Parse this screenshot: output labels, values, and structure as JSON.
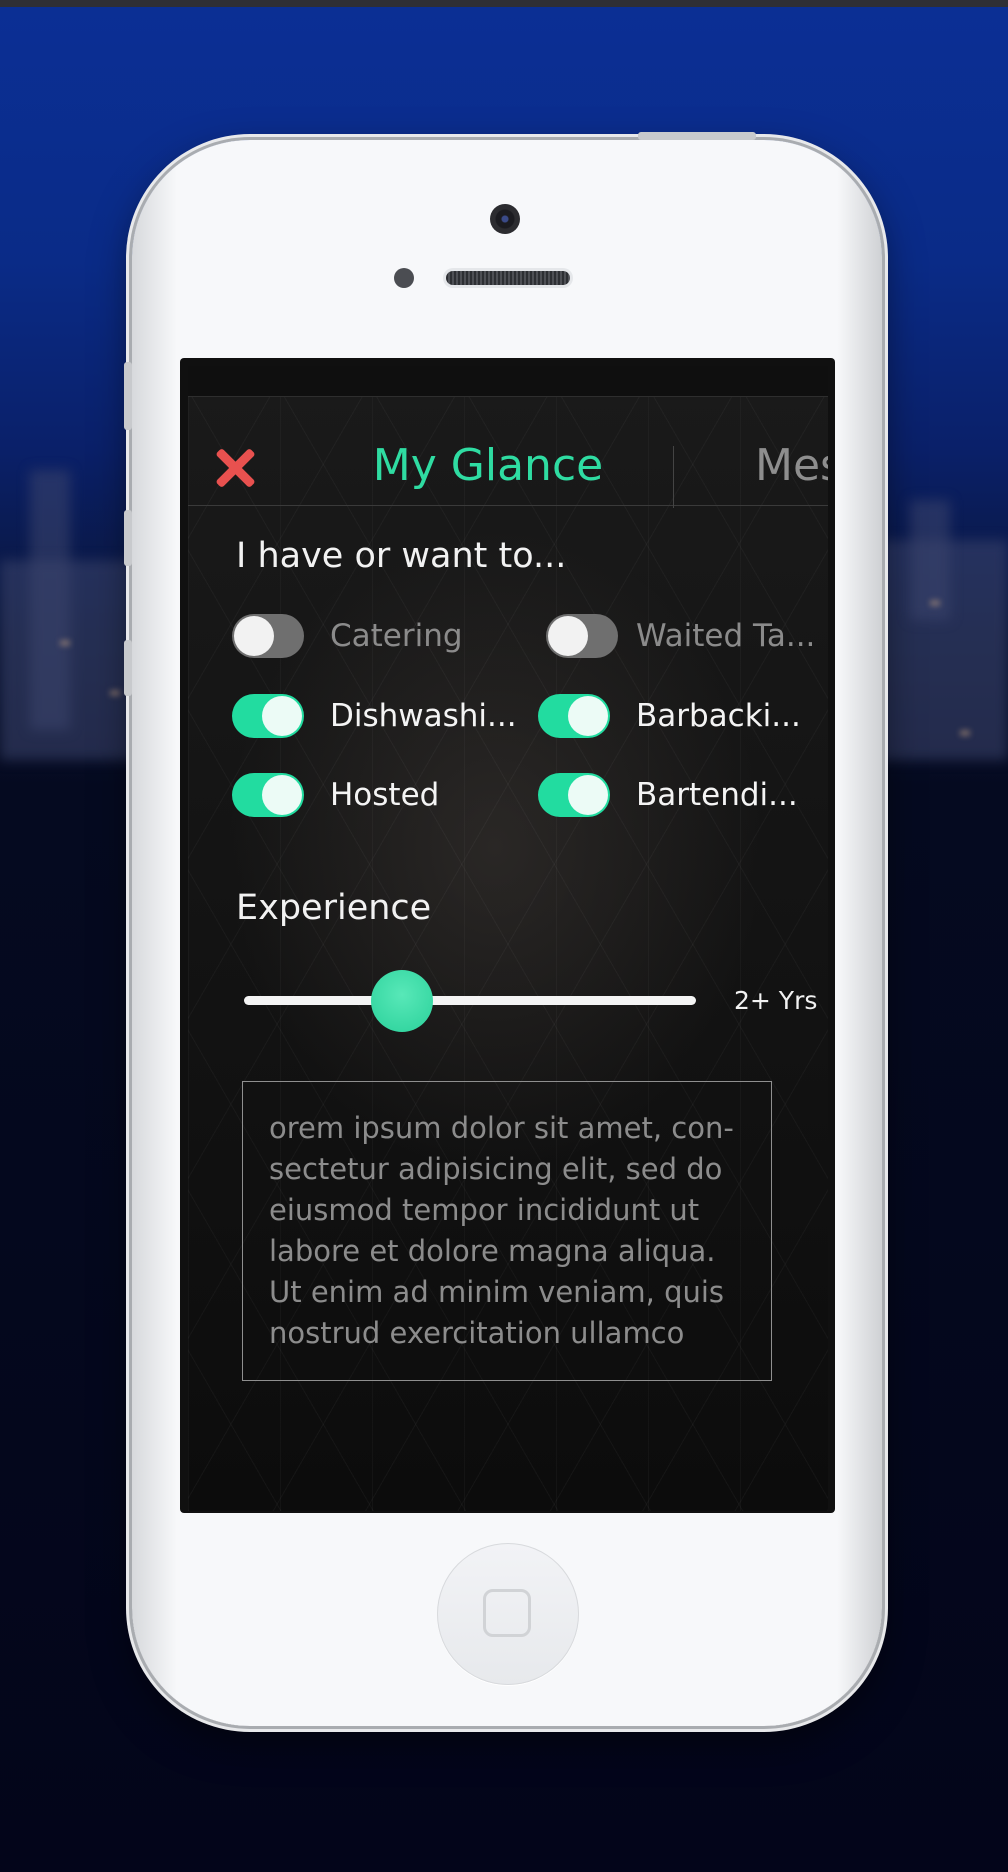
{
  "nav": {
    "title": "My Glance",
    "next_tab": "Mes"
  },
  "services": {
    "heading": "I have or want to...",
    "items": [
      {
        "label": "Catering",
        "on": false
      },
      {
        "label": "Waited Ta...",
        "on": false
      },
      {
        "label": "Dishwashi...",
        "on": true
      },
      {
        "label": "Barbacki...",
        "on": true
      },
      {
        "label": "Hosted",
        "on": true
      },
      {
        "label": "Bartendi...",
        "on": true
      }
    ]
  },
  "experience": {
    "heading": "Experience",
    "value_label": "2+ Yrs",
    "level": 0.35
  },
  "bio": {
    "text": "orem ipsum dolor sit amet, con-\nsectetur adipisicing elit, sed do\neiusmod tempor incididunt ut\nlabore et dolore magna aliqua.\nUt enim ad minim veniam, quis\nnostrud exercitation ullamco"
  },
  "colors": {
    "accent": "#22dca0",
    "close": "#e8514f"
  }
}
